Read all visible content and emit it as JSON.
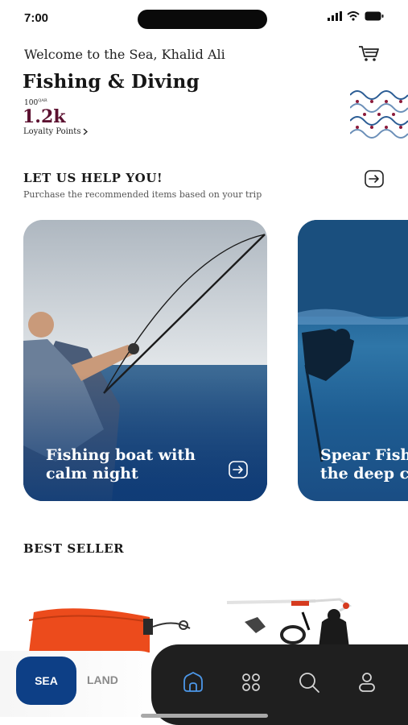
{
  "status": {
    "time": "7:00"
  },
  "header": {
    "welcome": "Welcome to the Sea, Khalid Ali",
    "title": "Fishing & Diving",
    "qar_value": "100",
    "qar_unit": "QAR",
    "points": "1.2k",
    "points_label": "Loyalty Points"
  },
  "help": {
    "title": "LET US HELP YOU!",
    "subtitle": "Purchase the recommended items based on your trip",
    "cards": [
      {
        "line1": "Fishing boat with",
        "line2": "calm night"
      },
      {
        "line1": "Spear Fish",
        "line2": "the deep c"
      }
    ]
  },
  "best_seller": {
    "title": "BEST SELLER"
  },
  "mode_toggle": {
    "sea": "SEA",
    "land": "LAND",
    "selected": "SEA"
  },
  "tabbar": {
    "items": [
      "home-icon",
      "grid-icon",
      "search-icon",
      "profile-icon"
    ],
    "active": "home-icon"
  },
  "colors": {
    "brand_blue": "#0d3f86",
    "points_maroon": "#5c1130",
    "tabbar_bg": "#1f1f1f"
  }
}
